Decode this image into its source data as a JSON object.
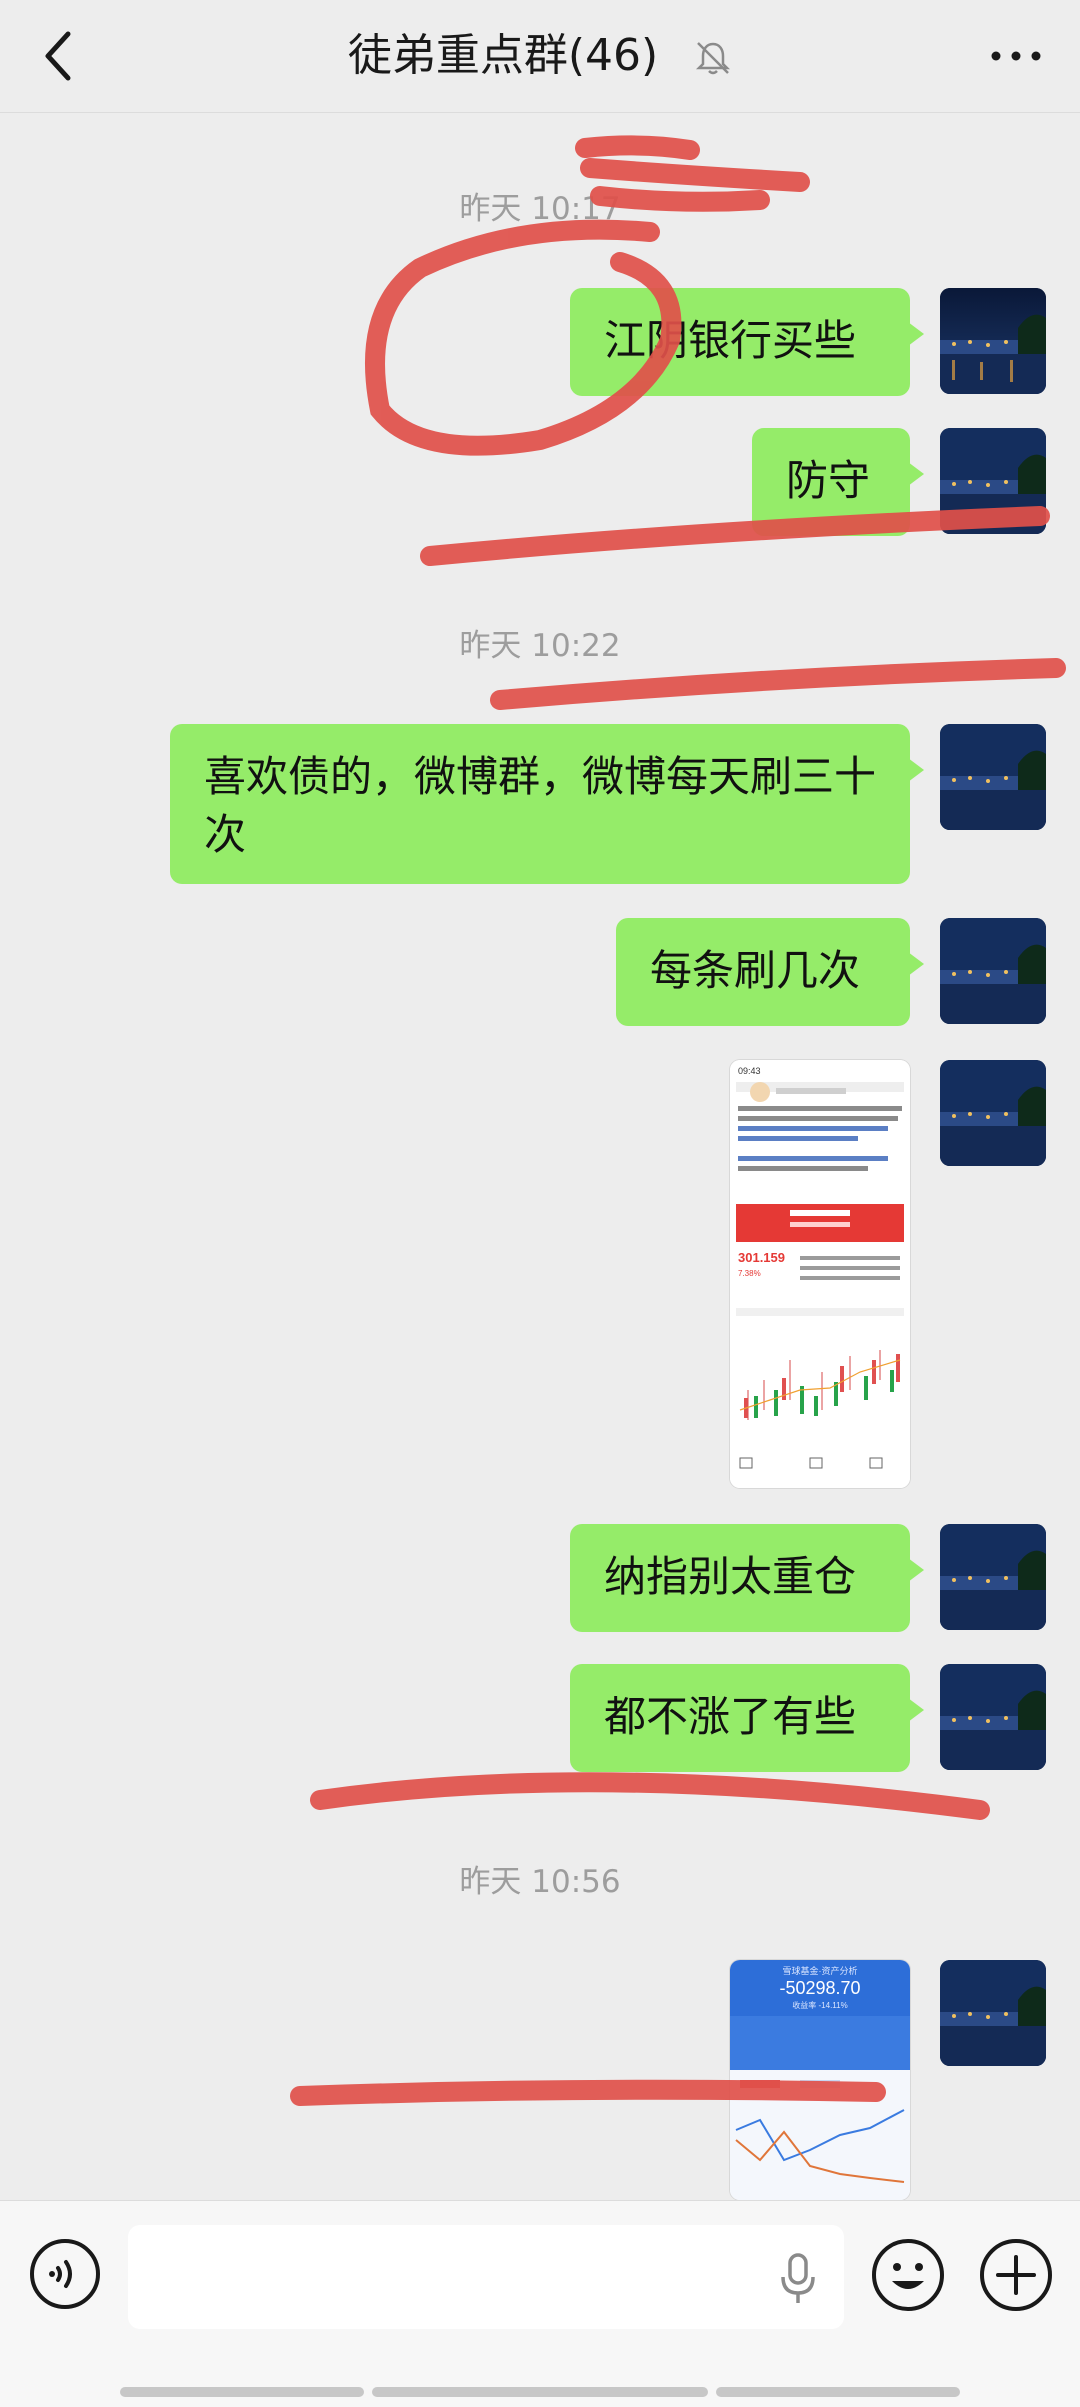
{
  "header": {
    "title": "徒弟重点群(46)",
    "muted": true
  },
  "timestamps": [
    "昨天 10:17",
    "昨天 10:22",
    "昨天 10:56"
  ],
  "messages": [
    {
      "text": "江阴银行买些"
    },
    {
      "text": "防守"
    },
    {
      "text": "喜欢债的，微博群，微博每天刷三十次"
    },
    {
      "text": "每条刷几次"
    },
    {
      "text": "纳指别太重仓"
    },
    {
      "text": "都不涨了有些"
    }
  ],
  "shared_images": {
    "stock_post": {
      "status_time": "09:43",
      "quote_price": "301.159",
      "quote_change": "7.38%"
    },
    "assets": {
      "app_name": "雪球基金·资产分析",
      "amount": "-50298.70",
      "return_rate": "收益率 -14.11%"
    }
  },
  "colors": {
    "bubble": "#95ec69",
    "background": "#ededed",
    "markup": "#e0504a"
  },
  "icons": [
    "back-icon",
    "mute-bell-icon",
    "more-icon",
    "voice-icon",
    "mic-icon",
    "emoji-icon",
    "plus-icon"
  ]
}
